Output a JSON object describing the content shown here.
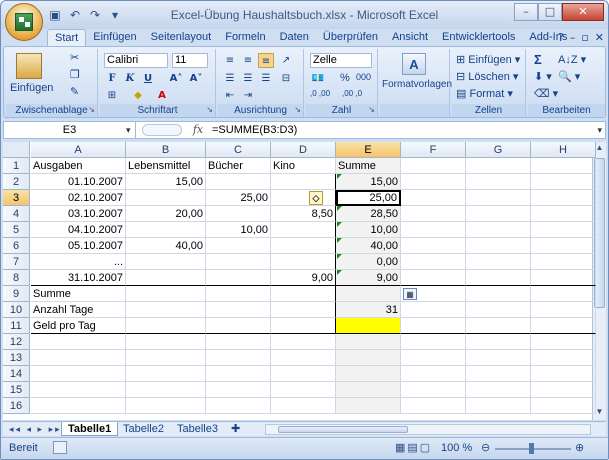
{
  "app": {
    "title": "Excel-Übung Haushaltsbuch.xlsx - Microsoft Excel"
  },
  "ribbon_tabs": [
    "Start",
    "Einfügen",
    "Seitenlayout",
    "Formeln",
    "Daten",
    "Überprüfen",
    "Ansicht",
    "Entwicklertools",
    "Add-Ins"
  ],
  "ribbon": {
    "clipboard_label": "Zwischenablage",
    "paste_label": "Einfügen",
    "font_group_label": "Schriftart",
    "font_name": "Calibri",
    "font_size": "11",
    "align_group_label": "Ausrichtung",
    "number_group_label": "Zahl",
    "number_format": "Zelle",
    "number_percent": "%",
    "number_thousands": "000",
    "dec_more": ",0 ,00",
    "dec_less": ",00 ,0",
    "styles_label": "Formatvorlagen",
    "cells_group_label": "Zellen",
    "cells_insert": "Einfügen",
    "cells_delete": "Löschen",
    "cells_format": "Format",
    "edit_group_label": "Bearbeiten",
    "sum_symbol": "Σ"
  },
  "formula_bar": {
    "name_box": "E3",
    "fx": "fx",
    "formula": "=SUMME(B3:D3)"
  },
  "columns": [
    "A",
    "B",
    "C",
    "D",
    "E",
    "F",
    "G",
    "H"
  ],
  "rows": [
    {
      "num": "1",
      "A": "Ausgaben",
      "B": "Lebensmittel",
      "C": "Bücher",
      "D": "Kino",
      "E": "Summe"
    },
    {
      "num": "2",
      "A": "01.10.2007",
      "B": "15,00",
      "C": "",
      "D": "",
      "E": "15,00"
    },
    {
      "num": "3",
      "A": "02.10.2007",
      "B": "",
      "C": "25,00",
      "D": "",
      "E": "25,00"
    },
    {
      "num": "4",
      "A": "03.10.2007",
      "B": "20,00",
      "C": "",
      "D": "8,50",
      "E": "28,50"
    },
    {
      "num": "5",
      "A": "04.10.2007",
      "B": "",
      "C": "10,00",
      "D": "",
      "E": "10,00"
    },
    {
      "num": "6",
      "A": "05.10.2007",
      "B": "40,00",
      "C": "",
      "D": "",
      "E": "40,00"
    },
    {
      "num": "7",
      "A": "...",
      "B": "",
      "C": "",
      "D": "",
      "E": "0,00"
    },
    {
      "num": "8",
      "A": "31.10.2007",
      "B": "",
      "C": "",
      "D": "9,00",
      "E": "9,00"
    },
    {
      "num": "9",
      "A": "Summe",
      "B": "",
      "C": "",
      "D": "",
      "E": ""
    },
    {
      "num": "10",
      "A": "Anzahl Tage",
      "B": "",
      "C": "",
      "D": "",
      "E": "31"
    },
    {
      "num": "11",
      "A": "Geld pro Tag",
      "B": "",
      "C": "",
      "D": "",
      "E": ""
    },
    {
      "num": "12",
      "A": "",
      "B": "",
      "C": "",
      "D": "",
      "E": ""
    },
    {
      "num": "13",
      "A": "",
      "B": "",
      "C": "",
      "D": "",
      "E": ""
    },
    {
      "num": "14",
      "A": "",
      "B": "",
      "C": "",
      "D": "",
      "E": ""
    },
    {
      "num": "15",
      "A": "",
      "B": "",
      "C": "",
      "D": "",
      "E": ""
    },
    {
      "num": "16",
      "A": "",
      "B": "",
      "C": "",
      "D": "",
      "E": ""
    }
  ],
  "sheet_tabs": [
    "Tabelle1",
    "Tabelle2",
    "Tabelle3"
  ],
  "status": {
    "mode": "Bereit",
    "zoom": "100 %"
  },
  "colors": {
    "selection_header": "#f5c46b",
    "highlight": "#ffff00",
    "accent": "#15428b"
  }
}
